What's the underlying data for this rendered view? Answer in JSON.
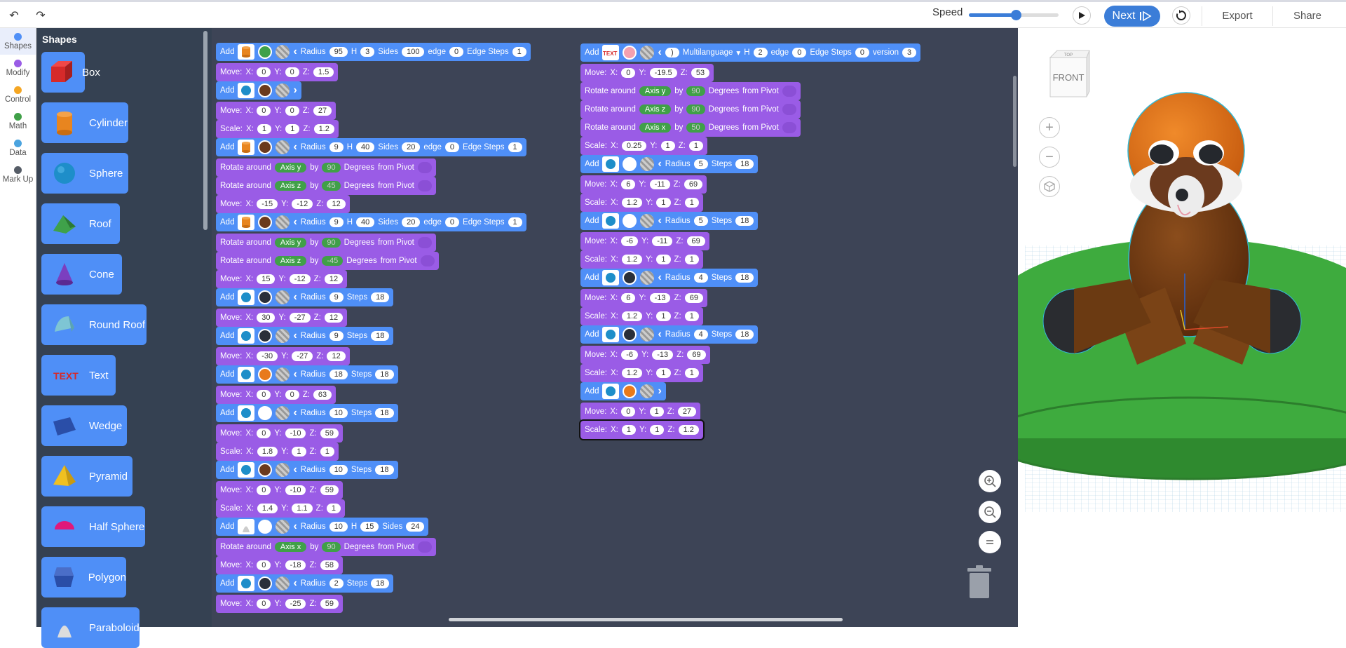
{
  "toolbar": {
    "undo": "↶",
    "redo": "↷",
    "speed_label": "Speed",
    "speed_value": 0.52,
    "next_label": "Next",
    "export_label": "Export",
    "share_label": "Share"
  },
  "categories": [
    {
      "label": "Shapes",
      "color": "#4f8ff7"
    },
    {
      "label": "Modify",
      "color": "#9a5ce6"
    },
    {
      "label": "Control",
      "color": "#f5a623"
    },
    {
      "label": "Math",
      "color": "#40a048"
    },
    {
      "label": "Data",
      "color": "#4aa3df"
    },
    {
      "label": "Mark Up",
      "color": "#555c66"
    }
  ],
  "palette": {
    "title": "Shapes",
    "items": [
      {
        "label": "Box",
        "icon": "box-icon"
      },
      {
        "label": "Cylinder",
        "icon": "cylinder-icon"
      },
      {
        "label": "Sphere",
        "icon": "sphere-icon"
      },
      {
        "label": "Roof",
        "icon": "roof-icon"
      },
      {
        "label": "Cone",
        "icon": "cone-icon"
      },
      {
        "label": "Round Roof",
        "icon": "round-roof-icon"
      },
      {
        "label": "Text",
        "icon": "text-icon"
      },
      {
        "label": "Wedge",
        "icon": "wedge-icon"
      },
      {
        "label": "Pyramid",
        "icon": "pyramid-icon"
      },
      {
        "label": "Half Sphere",
        "icon": "half-sphere-icon"
      },
      {
        "label": "Polygon",
        "icon": "polygon-icon"
      },
      {
        "label": "Paraboloid",
        "icon": "paraboloid-icon"
      }
    ]
  },
  "labels": {
    "add": "Add",
    "move": "Move:",
    "scale": "Scale:",
    "rotate": "Rotate around",
    "by": "by",
    "degrees": "Degrees",
    "from_pivot": "from Pivot",
    "radius": "Radius",
    "h": "H",
    "sides": "Sides",
    "edge": "edge",
    "edge_steps": "Edge Steps",
    "steps": "Steps",
    "x": "X:",
    "y": "Y:",
    "z": "Z:",
    "multilanguage": "Multilanguage",
    "version": "version",
    "axis_y": "Axis y",
    "axis_z": "Axis z",
    "axis_x": "Axis x",
    "ninety": "90",
    "forty_five": "45",
    "neg_forty_five": "-45",
    "fifty": "50",
    "text_chip": ")"
  },
  "col1": [
    {
      "k": "add",
      "shape": "cylinder",
      "color": "#3fa14a",
      "chev": "<",
      "p": {
        "r": "95",
        "h": "3",
        "sides": "100",
        "edge": "0",
        "es": "1"
      }
    },
    {
      "k": "move",
      "v": [
        "0",
        "0",
        "1.5"
      ]
    },
    {
      "k": "add",
      "shape": "sphere",
      "color": "#6b3a1e",
      "chev": ">"
    },
    {
      "k": "move",
      "v": [
        "0",
        "0",
        "27"
      ]
    },
    {
      "k": "scale",
      "v": [
        "1",
        "1",
        "1.2"
      ]
    },
    {
      "k": "add",
      "shape": "cylinder",
      "color": "#6b3a1e",
      "chev": "<",
      "p": {
        "r": "9",
        "h": "40",
        "sides": "20",
        "edge": "0",
        "es": "1"
      }
    },
    {
      "k": "rot",
      "axis": "Axis y",
      "deg": "90"
    },
    {
      "k": "rot",
      "axis": "Axis z",
      "deg": "45"
    },
    {
      "k": "move",
      "v": [
        "-15",
        "-12",
        "12"
      ]
    },
    {
      "k": "add",
      "shape": "cylinder",
      "color": "#6b3a1e",
      "chev": "<",
      "p": {
        "r": "9",
        "h": "40",
        "sides": "20",
        "edge": "0",
        "es": "1"
      }
    },
    {
      "k": "rot",
      "axis": "Axis y",
      "deg": "90"
    },
    {
      "k": "rot",
      "axis": "Axis z",
      "deg": "-45"
    },
    {
      "k": "move",
      "v": [
        "15",
        "-12",
        "12"
      ]
    },
    {
      "k": "add",
      "shape": "sphere",
      "color": "#2a2f3a",
      "chev": "<",
      "p": {
        "r": "9",
        "steps": "18"
      }
    },
    {
      "k": "move",
      "v": [
        "30",
        "-27",
        "12"
      ]
    },
    {
      "k": "add",
      "shape": "sphere",
      "color": "#2a2f3a",
      "chev": "<",
      "p": {
        "r": "9",
        "steps": "18"
      }
    },
    {
      "k": "move",
      "v": [
        "-30",
        "-27",
        "12"
      ]
    },
    {
      "k": "add",
      "shape": "sphere",
      "color": "#e87a1c",
      "chev": "<",
      "p": {
        "r": "18",
        "steps": "18"
      }
    },
    {
      "k": "move",
      "v": [
        "0",
        "0",
        "63"
      ]
    },
    {
      "k": "add",
      "shape": "sphere",
      "color": "#ffffff",
      "chev": "<",
      "p": {
        "r": "10",
        "steps": "18"
      }
    },
    {
      "k": "move",
      "v": [
        "0",
        "-10",
        "59"
      ]
    },
    {
      "k": "scale",
      "v": [
        "1.8",
        "1",
        "1"
      ]
    },
    {
      "k": "add",
      "shape": "sphere",
      "color": "#6b3a1e",
      "chev": "<",
      "p": {
        "r": "10",
        "steps": "18"
      }
    },
    {
      "k": "move",
      "v": [
        "0",
        "-10",
        "59"
      ]
    },
    {
      "k": "scale",
      "v": [
        "1.4",
        "1.1",
        "1"
      ]
    },
    {
      "k": "add",
      "shape": "paraboloid",
      "color": "#ffffff",
      "chev": "<",
      "p": {
        "r": "10",
        "h": "15",
        "sides": "24"
      }
    },
    {
      "k": "rot",
      "axis": "Axis x",
      "deg": "90"
    },
    {
      "k": "move",
      "v": [
        "0",
        "-18",
        "58"
      ]
    },
    {
      "k": "add",
      "shape": "sphere",
      "color": "#2a2f3a",
      "chev": "<",
      "p": {
        "r": "2",
        "steps": "18"
      }
    },
    {
      "k": "move",
      "v": [
        "0",
        "-25",
        "59"
      ]
    }
  ],
  "col2": [
    {
      "k": "add",
      "shape": "text",
      "color": "#f4a0b0",
      "chev": "<",
      "p": {
        "text": true,
        "h": "2",
        "edge": "0",
        "es": "0",
        "ver": "3"
      }
    },
    {
      "k": "move",
      "v": [
        "0",
        "-19.5",
        "53"
      ]
    },
    {
      "k": "rot",
      "axis": "Axis y",
      "deg": "90"
    },
    {
      "k": "rot",
      "axis": "Axis z",
      "deg": "90"
    },
    {
      "k": "rot",
      "axis": "Axis x",
      "deg": "50"
    },
    {
      "k": "scale",
      "v": [
        "0.25",
        "1",
        "1"
      ]
    },
    {
      "k": "add",
      "shape": "sphere",
      "color": "#ffffff",
      "chev": "<",
      "p": {
        "r": "5",
        "steps": "18"
      }
    },
    {
      "k": "move",
      "v": [
        "6",
        "-11",
        "69"
      ]
    },
    {
      "k": "scale",
      "v": [
        "1.2",
        "1",
        "1"
      ]
    },
    {
      "k": "add",
      "shape": "sphere",
      "color": "#ffffff",
      "chev": "<",
      "p": {
        "r": "5",
        "steps": "18"
      }
    },
    {
      "k": "move",
      "v": [
        "-6",
        "-11",
        "69"
      ]
    },
    {
      "k": "scale",
      "v": [
        "1.2",
        "1",
        "1"
      ]
    },
    {
      "k": "add",
      "shape": "sphere",
      "color": "#2a2f3a",
      "chev": "<",
      "p": {
        "r": "4",
        "steps": "18"
      }
    },
    {
      "k": "move",
      "v": [
        "6",
        "-13",
        "69"
      ]
    },
    {
      "k": "scale",
      "v": [
        "1.2",
        "1",
        "1"
      ]
    },
    {
      "k": "add",
      "shape": "sphere",
      "color": "#2a2f3a",
      "chev": "<",
      "p": {
        "r": "4",
        "steps": "18"
      }
    },
    {
      "k": "move",
      "v": [
        "-6",
        "-13",
        "69"
      ]
    },
    {
      "k": "scale",
      "v": [
        "1.2",
        "1",
        "1"
      ]
    },
    {
      "k": "add",
      "shape": "sphere",
      "color": "#e87a1c",
      "chev": ">"
    },
    {
      "k": "move",
      "v": [
        "0",
        "1",
        "27"
      ]
    },
    {
      "k": "scale",
      "v": [
        "1",
        "1",
        "1.2"
      ]
    }
  ],
  "viewport": {
    "cube_top": "TOP",
    "cube_front": "FRONT",
    "plus": "+",
    "minus": "−"
  }
}
